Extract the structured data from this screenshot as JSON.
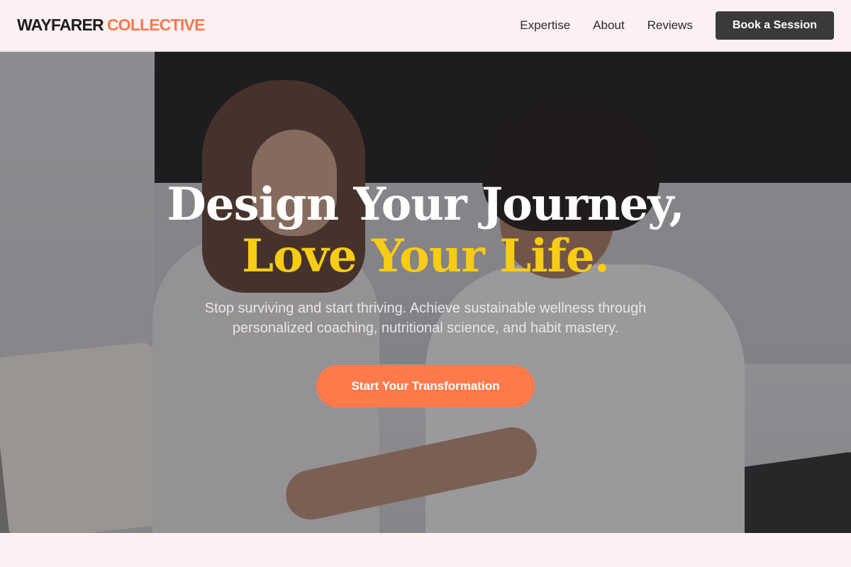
{
  "header": {
    "logo_part1": "WAYFARER",
    "logo_part2": "COLLECTIVE",
    "nav": [
      "Expertise",
      "About",
      "Reviews"
    ],
    "book_label": "Book a Session"
  },
  "hero": {
    "headline_line1": "Design Your Journey,",
    "headline_line2": "Love Your Life.",
    "subtitle": "Stop surviving and start thriving. Achieve sustainable wellness through personalized coaching, nutritional science, and habit mastery.",
    "cta_label": "Start Your Transformation",
    "image_description_icon": "hero-photo"
  },
  "colors": {
    "accent": "#ff7a4a",
    "highlight": "#f7cc15",
    "dark_button": "#3a3a3c",
    "background": "#fdf0f3"
  }
}
